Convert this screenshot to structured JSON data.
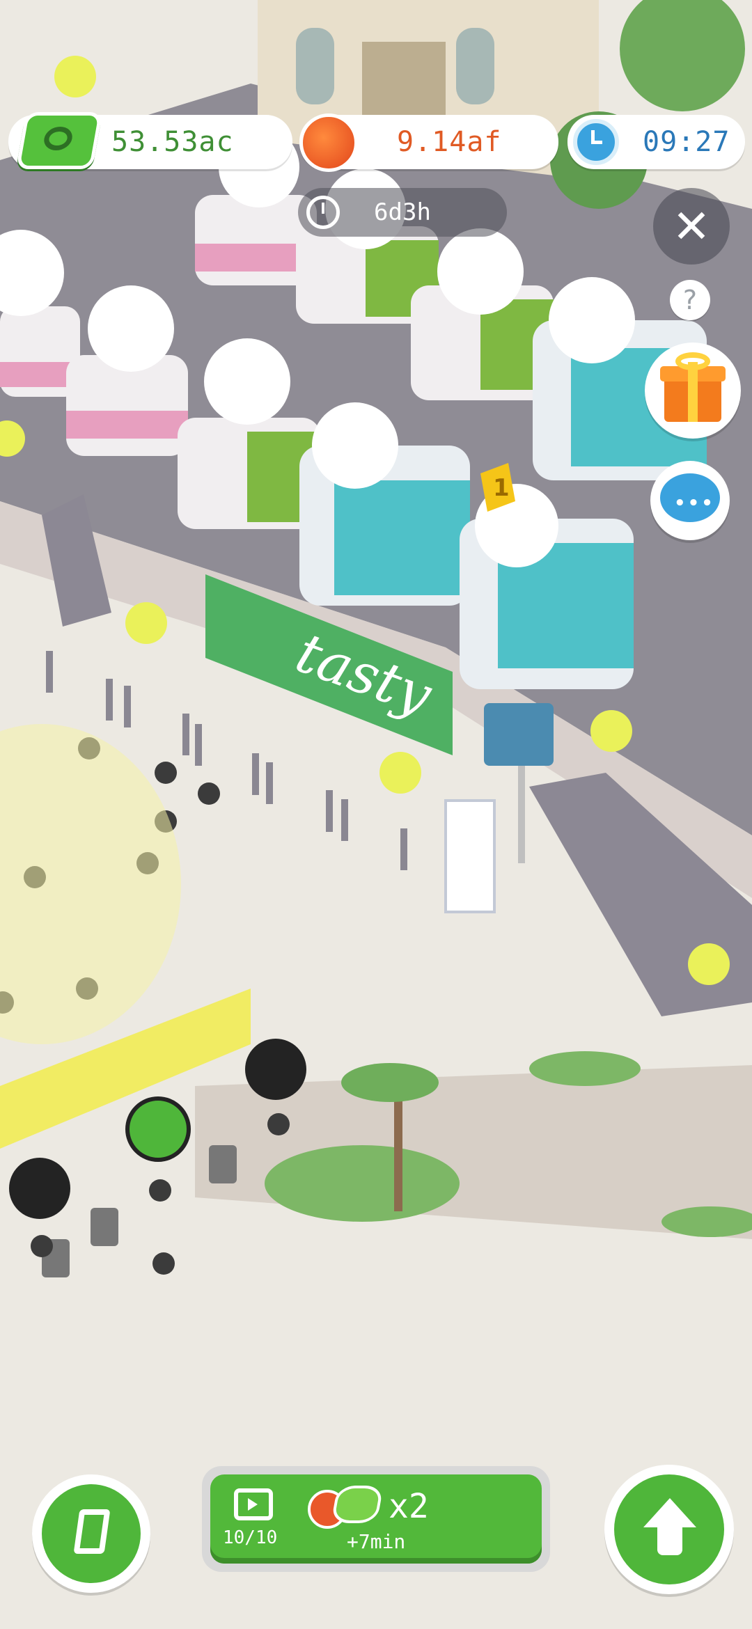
{
  "hud": {
    "currency_green": "53.53ac",
    "currency_orange": "9.14af",
    "clock_time": "09:27"
  },
  "event_timer": "6d3h",
  "buttons": {
    "close": "✕",
    "help": "?"
  },
  "rank_badge": "1",
  "boost": {
    "ads_count": "10/10",
    "multiplier": "x2",
    "bonus_time": "+7min"
  },
  "banner_text": "tasty",
  "colors": {
    "brand_green": "#4fb63a",
    "currency_green": "#3f8f35",
    "currency_orange": "#e05a24",
    "clock_blue": "#2a78b8"
  }
}
